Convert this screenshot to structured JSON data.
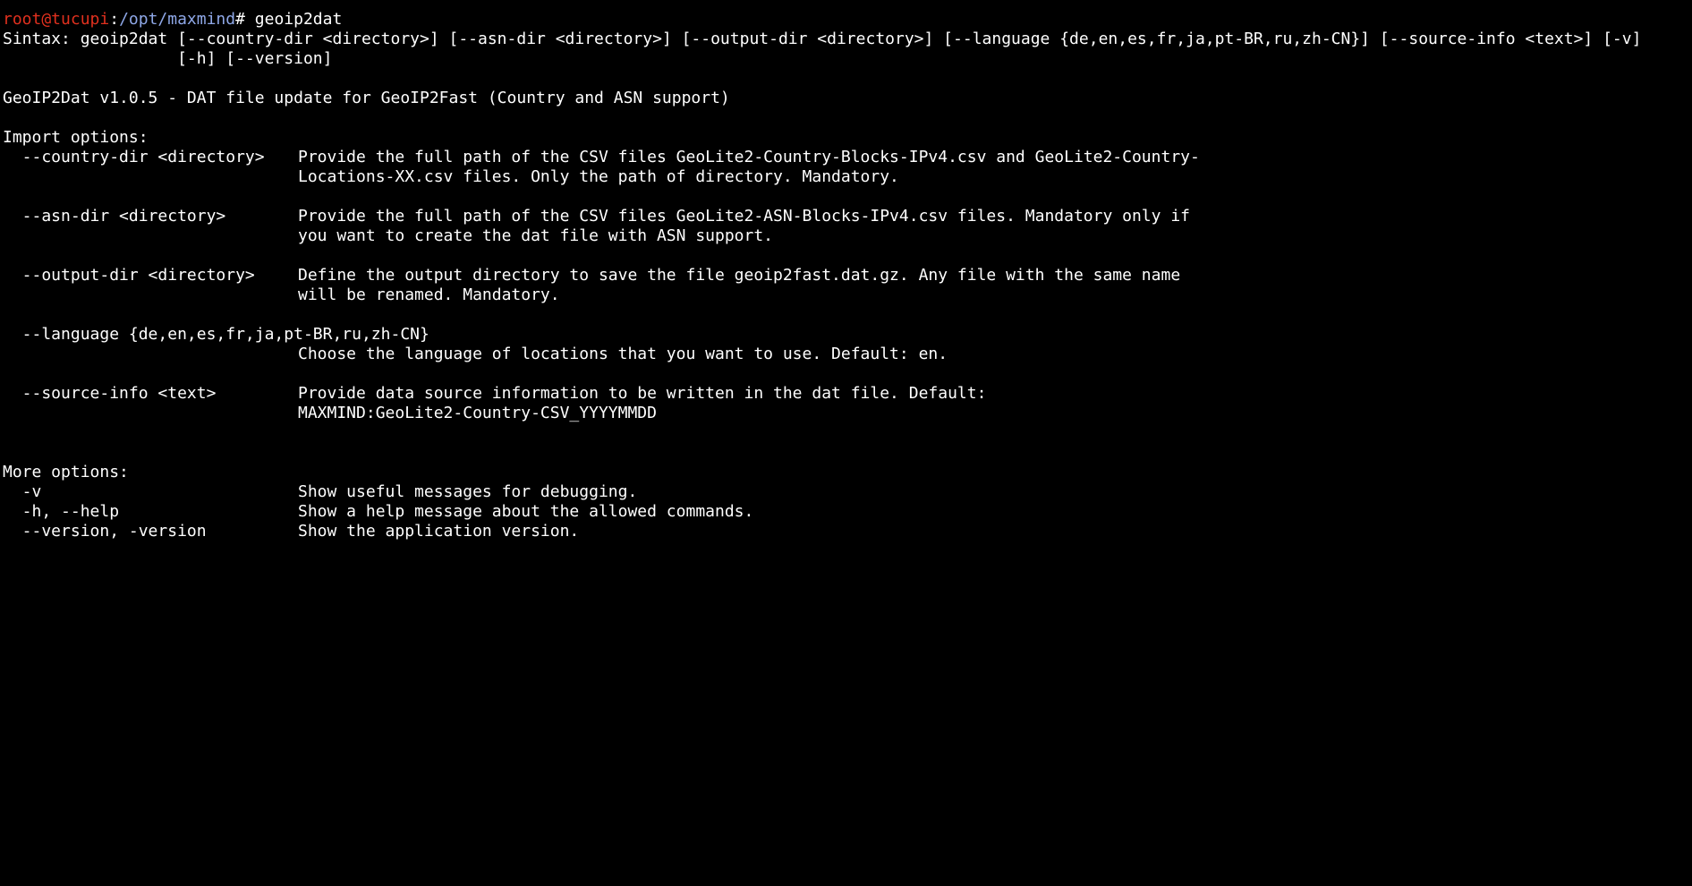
{
  "colors": {
    "background": "#000000",
    "text": "#ffffff",
    "prompt_user": "#e0301e",
    "prompt_path": "#8fa8e8"
  },
  "prompt": {
    "user_host": "root@tucupi",
    "colon": ":",
    "path": "/opt/maxmind",
    "symbol": "#",
    "command": " geoip2dat"
  },
  "syntax": {
    "line1": "Sintax: geoip2dat [--country-dir <directory>] [--asn-dir <directory>] [--output-dir <directory>] [--language {de,en,es,fr,ja,pt-BR,ru,zh-CN}] [--source-info <text>] [-v]",
    "line2": "                  [-h] [--version]"
  },
  "banner": "GeoIP2Dat v1.0.5 - DAT file update for GeoIP2Fast (Country and ASN support)",
  "import_options": {
    "heading": "Import options:",
    "country_dir": {
      "flag": "  --country-dir <directory>",
      "desc1": "Provide the full path of the CSV files GeoLite2-Country-Blocks-IPv4.csv and GeoLite2-Country-",
      "desc2": "Locations-XX.csv files. Only the path of directory. Mandatory."
    },
    "asn_dir": {
      "flag": "  --asn-dir <directory>",
      "desc1": "Provide the full path of the CSV files GeoLite2-ASN-Blocks-IPv4.csv files. Mandatory only if",
      "desc2": "you want to create the dat file with ASN support."
    },
    "output_dir": {
      "flag": "  --output-dir <directory>",
      "desc1": "Define the output directory to save the file geoip2fast.dat.gz. Any file with the same name",
      "desc2": "will be renamed. Mandatory."
    },
    "language": {
      "flag": "  --language {de,en,es,fr,ja,pt-BR,ru,zh-CN}",
      "desc1": "Choose the language of locations that you want to use. Default: en."
    },
    "source_info": {
      "flag": "  --source-info <text>",
      "desc1": "Provide data source information to be written in the dat file. Default:",
      "desc2": "MAXMIND:GeoLite2-Country-CSV_YYYYMMDD"
    }
  },
  "more_options": {
    "heading": "More options:",
    "verbose": {
      "flag": "  -v",
      "desc": "Show useful messages for debugging."
    },
    "help": {
      "flag": "  -h, --help",
      "desc": "Show a help message about the allowed commands."
    },
    "version": {
      "flag": "  --version, -version",
      "desc": "Show the application version."
    }
  }
}
